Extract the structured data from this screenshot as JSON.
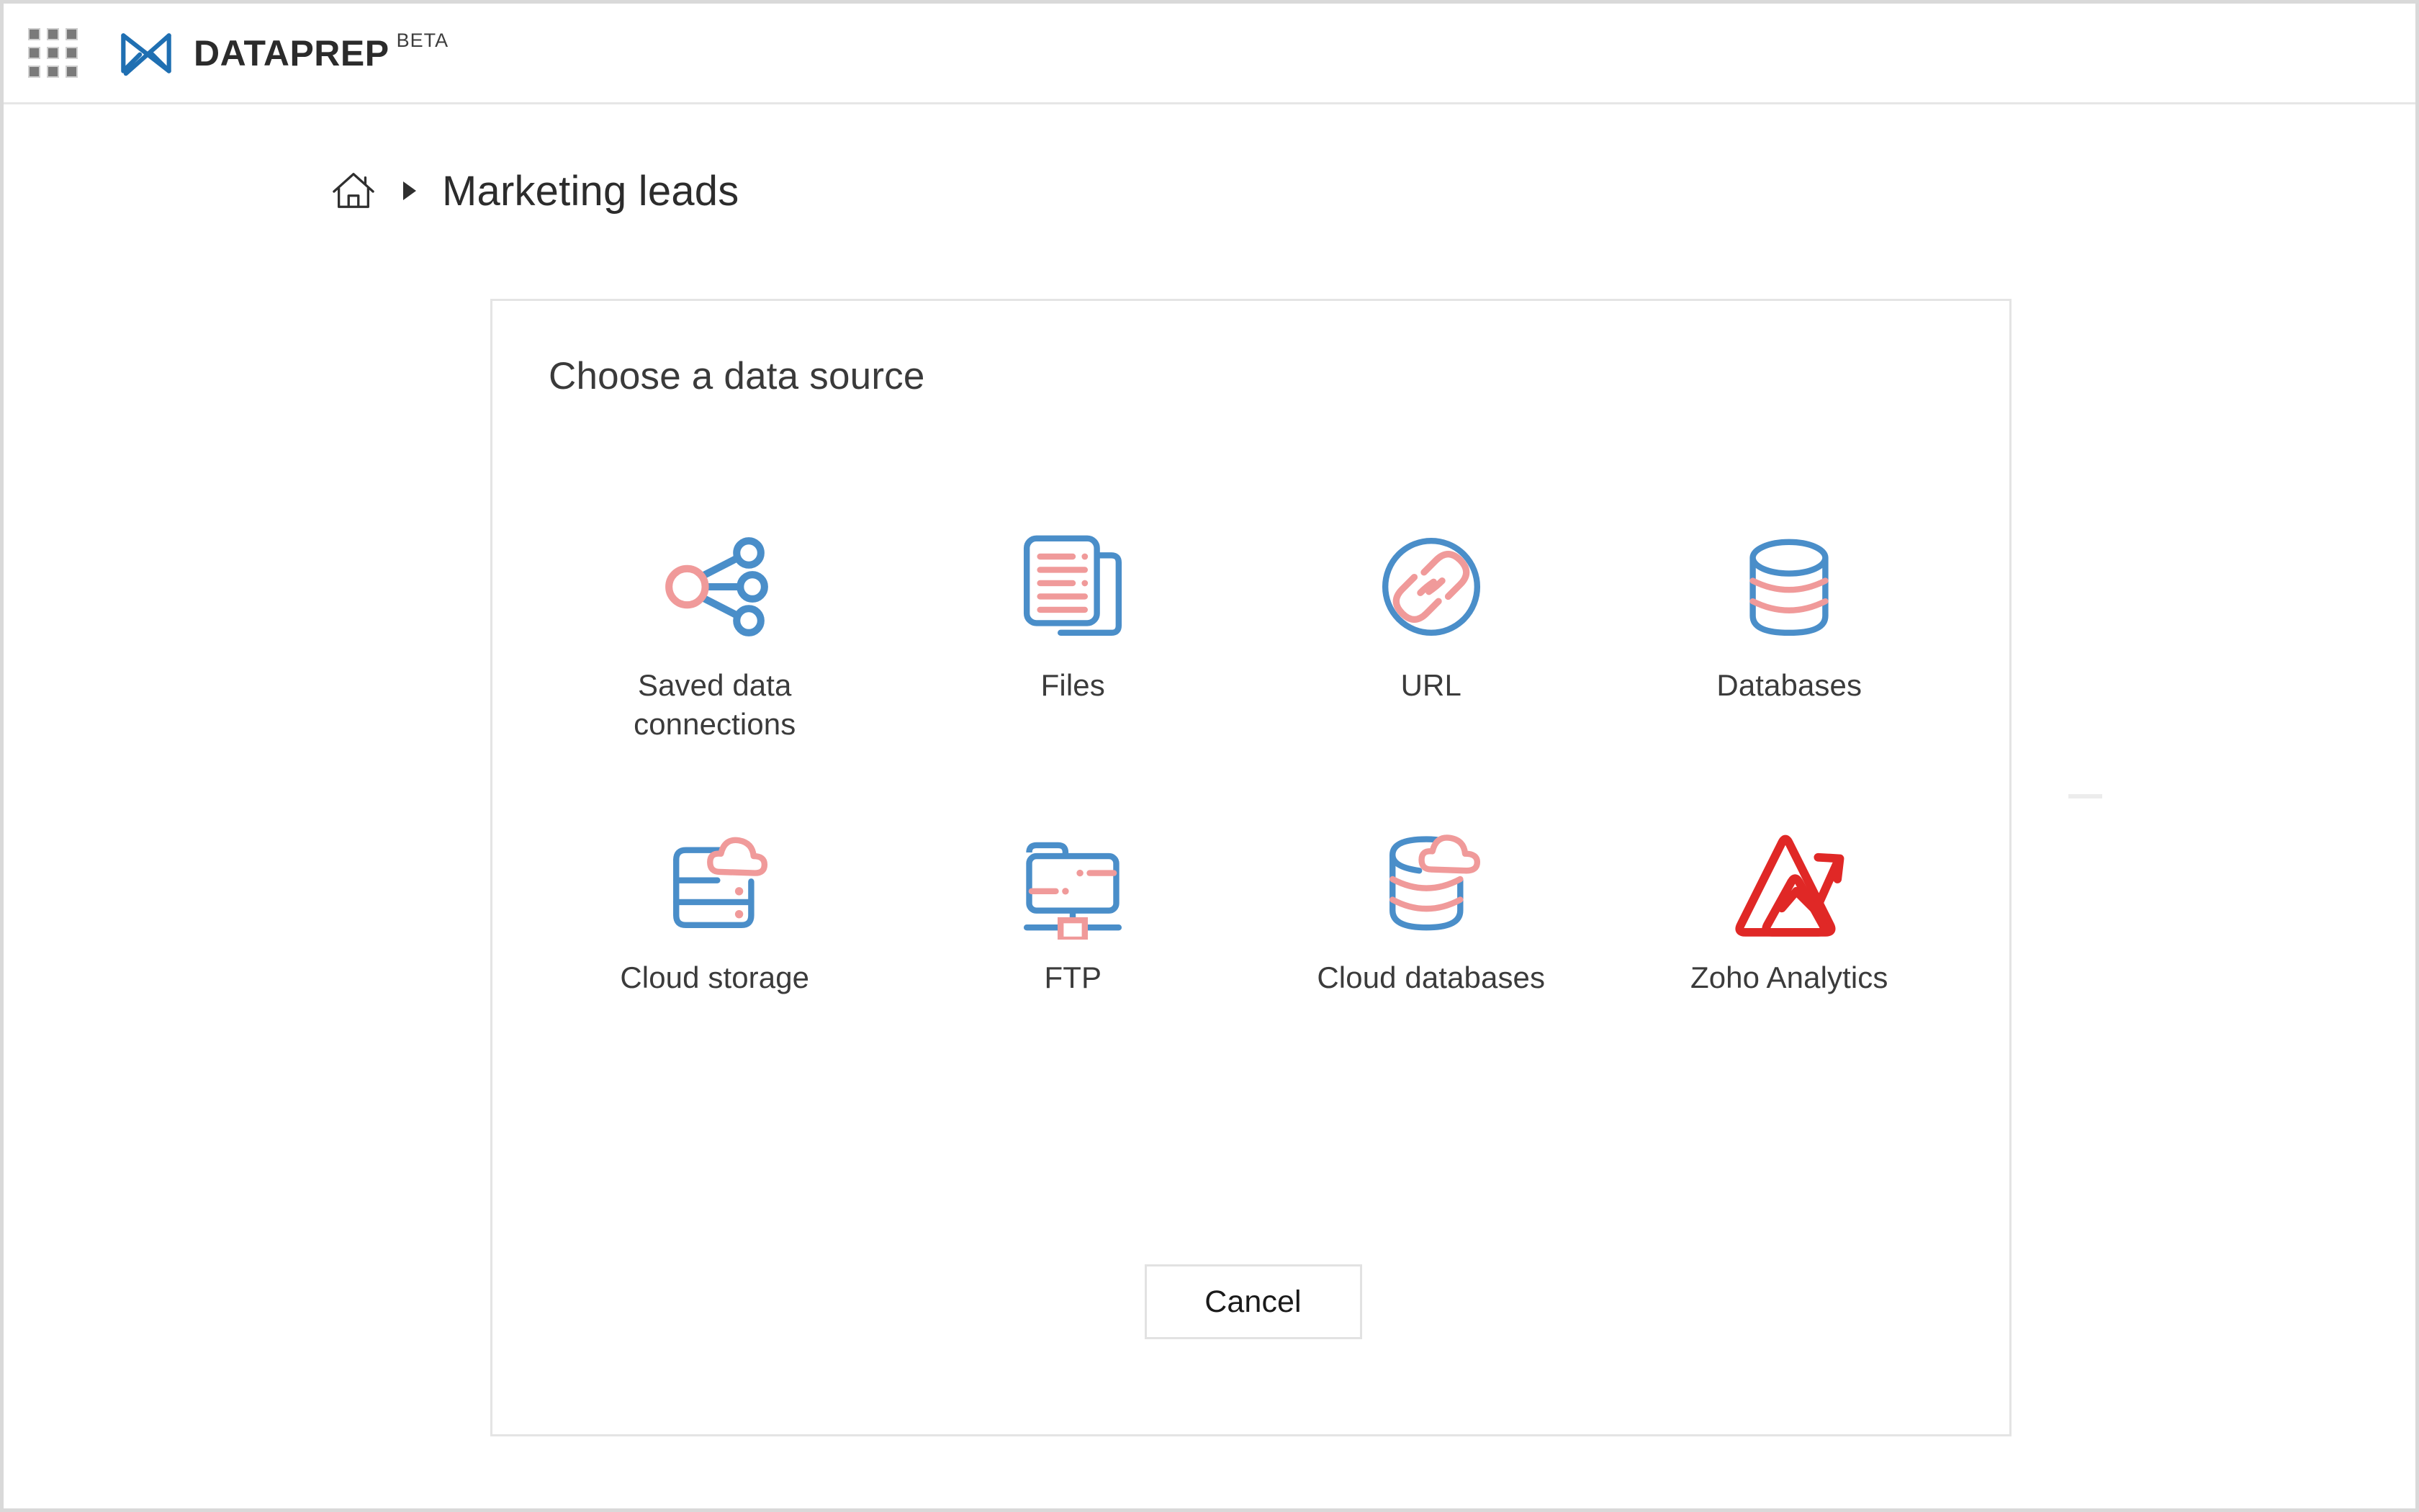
{
  "topbar": {
    "apps_icon": "app-grid-icon",
    "logo_icon": "dataprep-logo-icon",
    "brand_name": "DATAPREP",
    "brand_tag": "BETA"
  },
  "breadcrumb": {
    "home_icon": "home-icon",
    "separator": "chevron-right-icon",
    "title": "Marketing leads"
  },
  "card": {
    "title": "Choose a data source",
    "sources": [
      {
        "id": "saved-data-connections",
        "label": "Saved data connections",
        "icon": "share-nodes-icon"
      },
      {
        "id": "files",
        "label": "Files",
        "icon": "documents-icon"
      },
      {
        "id": "url",
        "label": "URL",
        "icon": "link-circle-icon"
      },
      {
        "id": "databases",
        "label": "Databases",
        "icon": "database-cylinder-icon"
      },
      {
        "id": "cloud-storage",
        "label": "Cloud storage",
        "icon": "cloud-server-icon"
      },
      {
        "id": "ftp",
        "label": "FTP",
        "icon": "folder-network-icon"
      },
      {
        "id": "cloud-databases",
        "label": "Cloud databases",
        "icon": "cloud-database-icon"
      },
      {
        "id": "zoho-analytics",
        "label": "Zoho Analytics",
        "icon": "zoho-analytics-logo-icon"
      }
    ],
    "cancel_label": "Cancel"
  },
  "colors": {
    "blue": "#4a8ec9",
    "brand_blue": "#1f6fb2",
    "salmon": "#f09a9a",
    "zoho_red": "#e02826",
    "text": "#3b3b3b",
    "border": "#e4e4e4"
  }
}
